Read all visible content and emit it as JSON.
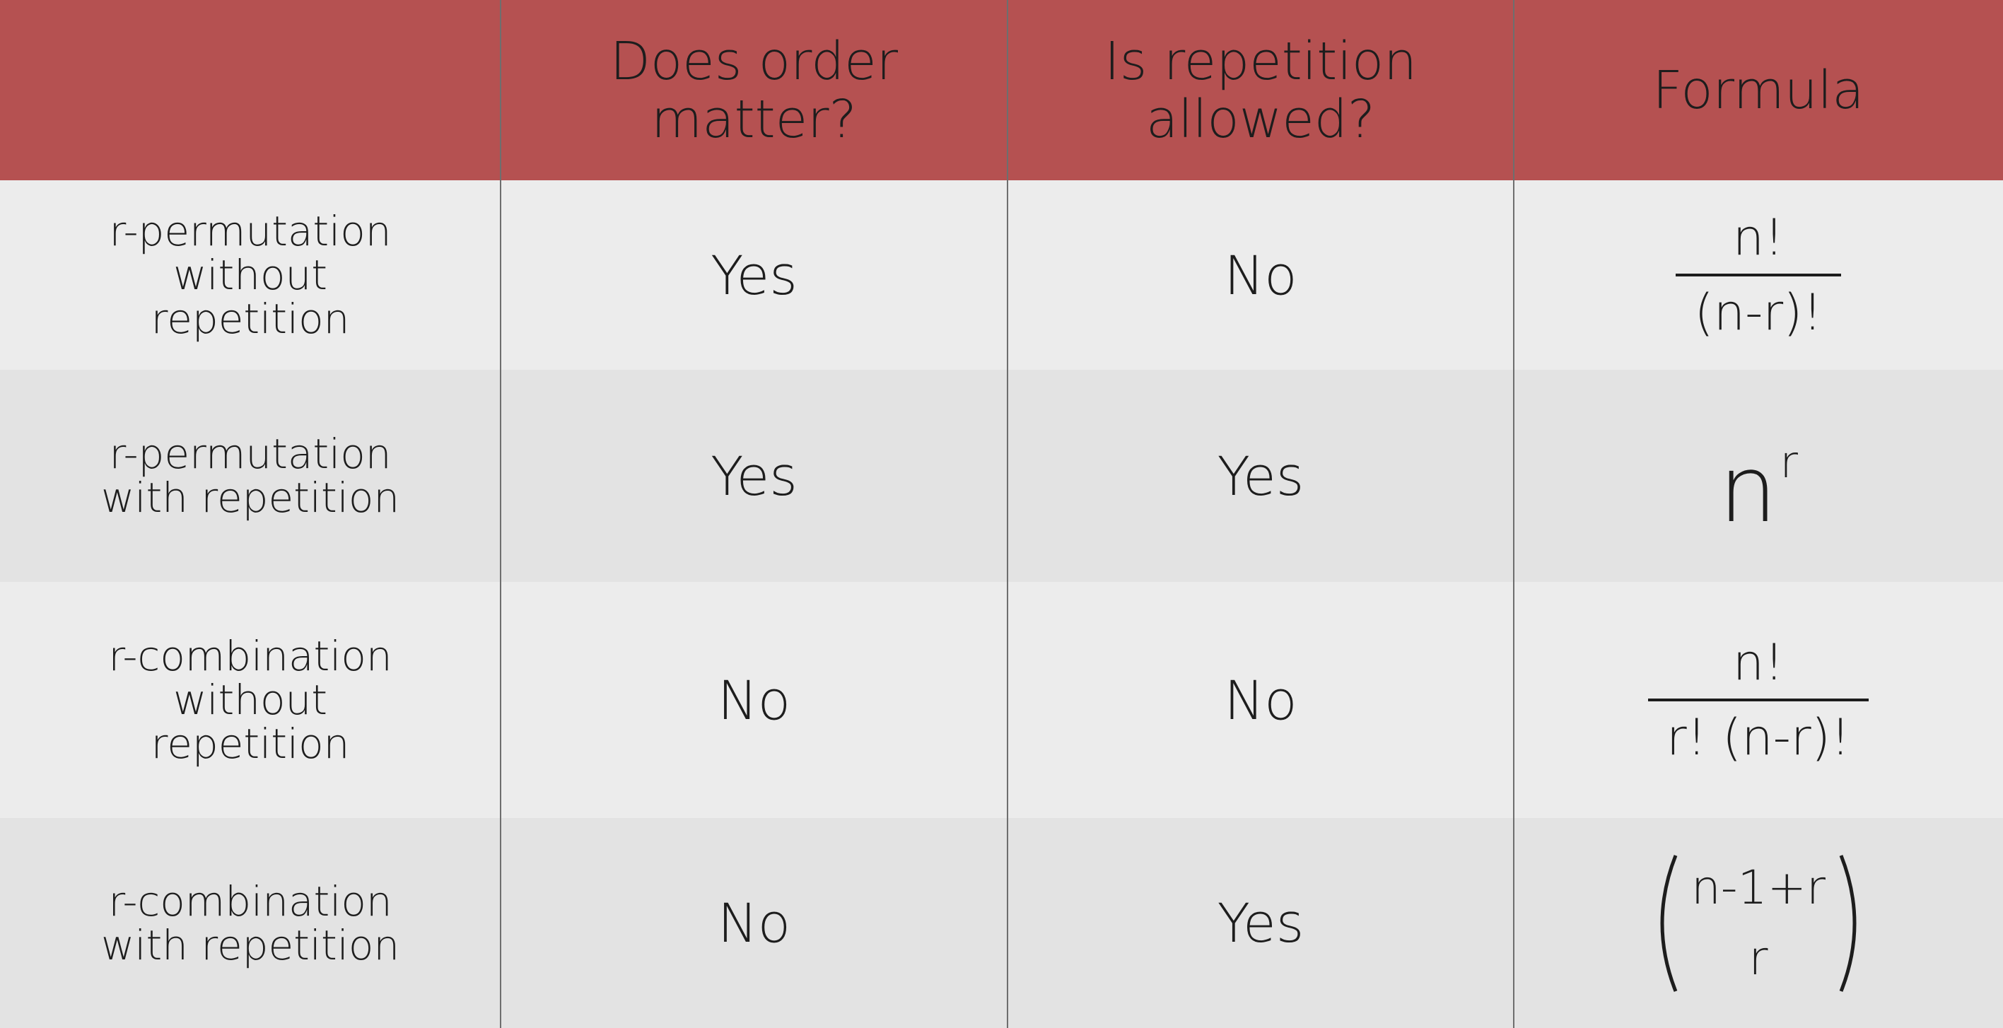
{
  "headers": [
    "",
    "Does order\nmatter?",
    "Is repetition\nallowed?",
    "Formula"
  ],
  "rows": [
    {
      "label": "r-permutation\nwithout\nrepetition",
      "order": "Yes",
      "repetition": "No",
      "formula": {
        "numerator": "n!",
        "denominator": "(n-r)!"
      }
    },
    {
      "label": "r-permutation\nwith repetition",
      "order": "Yes",
      "repetition": "Yes",
      "formula": {
        "base": "n",
        "exponent": "r"
      }
    },
    {
      "label": "r-combination\nwithout\nrepetition",
      "order": "No",
      "repetition": "No",
      "formula": {
        "numerator": "n!",
        "denominator": "r! (n-r)!"
      }
    },
    {
      "label": "r-combination\nwith repetition",
      "order": "No",
      "repetition": "Yes",
      "formula": {
        "top": "n-1+r",
        "bottom": "r"
      }
    }
  ],
  "colors": {
    "header_bg": "#b55151",
    "row_light": "#ececec",
    "row_dark": "#e3e3e3"
  }
}
